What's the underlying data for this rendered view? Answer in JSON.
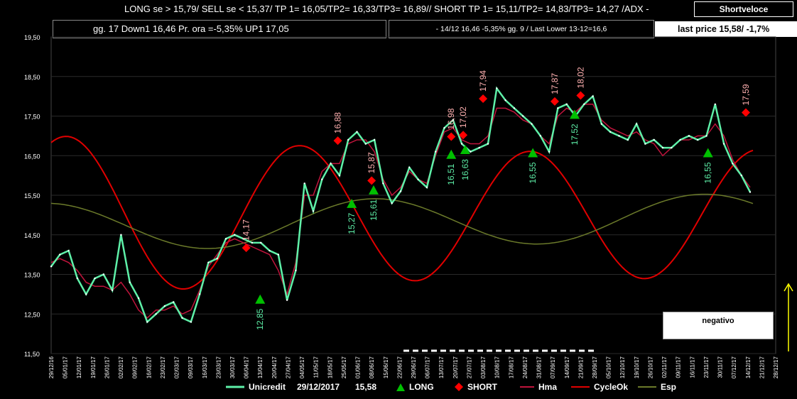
{
  "header": {
    "signals": "LONG se > 15,79/   SELL se < 15,37/ TP 1= 16,05/TP2= 16,33/TP3= 16,89//    SHORT TP 1= 15,11/TP2= 14,83/TP3= 14,27 /ADX -",
    "button": "Shortveloce"
  },
  "info": {
    "box1": "gg. 17  Down1  16,46  Pr. ora =-5,35%   UP1 17,05",
    "box2": "-  14/12  16,46  -5,35%  gg. 9 / Last Lower 13-12=16,6",
    "last_price": "last price 15,58/  -1,7%"
  },
  "status": {
    "label": "negativo"
  },
  "legend": {
    "unicredit": "Unicredit",
    "date": "29/12/2017",
    "price": "15,58",
    "long": "LONG",
    "short": "SHORT",
    "hma": "Hma",
    "cycleok": "CycleOk",
    "esp": "Esp"
  },
  "colors": {
    "price": "#5ef0a8",
    "long": "#00c000",
    "short": "#ff0000",
    "hma": "#c0143c",
    "cycleok": "#e00000",
    "esp": "#6b7a2a",
    "background": "#000000"
  },
  "chart_data": {
    "type": "line",
    "ylim": [
      11.5,
      19.5
    ],
    "yticks": [
      "11,50",
      "12,50",
      "13,50",
      "14,50",
      "15,50",
      "16,50",
      "17,50",
      "18,50",
      "19,50"
    ],
    "x_dates": [
      "29/12/16",
      "05/01/17",
      "12/01/17",
      "19/01/17",
      "26/01/17",
      "02/02/17",
      "09/02/17",
      "16/02/17",
      "23/02/17",
      "02/03/17",
      "09/03/17",
      "16/03/17",
      "23/03/17",
      "30/03/17",
      "06/04/17",
      "13/04/17",
      "20/04/17",
      "27/04/17",
      "04/05/17",
      "11/05/17",
      "18/05/17",
      "25/05/17",
      "01/06/17",
      "08/06/17",
      "15/06/17",
      "22/06/17",
      "29/06/17",
      "06/07/17",
      "13/07/17",
      "20/07/17",
      "27/07/17",
      "03/08/17",
      "10/08/17",
      "17/08/17",
      "24/08/17",
      "31/08/17",
      "07/09/17",
      "14/09/17",
      "21/09/17",
      "28/09/17",
      "05/10/17",
      "12/10/17",
      "19/10/17",
      "26/10/17",
      "02/11/17",
      "09/11/17",
      "16/11/17",
      "23/11/17",
      "30/11/17",
      "07/12/17",
      "14/12/17",
      "21/12/17",
      "28/12/17"
    ],
    "x_labels": [
      "29/12/16",
      "05/01/17",
      "12/01/17",
      "19/01/17",
      "26/01/17",
      "02/02/17",
      "09/02/17",
      "16/02/17",
      "23/02/17",
      "02/03/17",
      "09/03/17",
      "16/03/17",
      "23/03/17",
      "30/03/17",
      "06/04/17",
      "13/04/17",
      "20/04/17",
      "27/04/17",
      "04/05/17",
      "11/05/17",
      "18/05/17",
      "25/05/17",
      "01/06/17",
      "08/06/17",
      "15/06/17",
      "22/06/17",
      "29/06/17",
      "06/07/17",
      "13/07/17",
      "20/07/17",
      "27/07/17",
      "03/08/17",
      "10/08/17",
      "17/08/17",
      "24/08/17",
      "31/08/17",
      "07/09/17",
      "14/09/17",
      "21/09/17",
      "28/09/17",
      "05/10/17",
      "12/10/17",
      "19/10/17",
      "26/10/17",
      "02/11/17",
      "09/11/17",
      "16/11/17",
      "23/11/17",
      "30/11/17",
      "07/12/17",
      "14/12/17",
      "21/12/17",
      "28/12/17"
    ],
    "series": [
      {
        "name": "Unicredit",
        "values": [
          13.7,
          14.0,
          14.1,
          13.4,
          13.0,
          13.4,
          13.5,
          13.1,
          14.5,
          13.3,
          12.9,
          12.3,
          12.5,
          12.7,
          12.8,
          12.4,
          12.3,
          13.0,
          13.8,
          13.9,
          14.4,
          14.5,
          14.4,
          14.3,
          14.3,
          14.1,
          14.0,
          12.85,
          13.6,
          15.8,
          15.1,
          15.9,
          16.3,
          16.0,
          16.9,
          17.1,
          16.8,
          16.9,
          15.8,
          15.3,
          15.6,
          16.2,
          15.9,
          15.7,
          16.6,
          17.2,
          17.4,
          16.8,
          16.6,
          16.7,
          16.8,
          18.2,
          17.9,
          17.7,
          17.5,
          17.3,
          17.0,
          16.6,
          17.7,
          17.8,
          17.5,
          17.8,
          18.0,
          17.3,
          17.1,
          17.0,
          16.9,
          17.3,
          16.8,
          16.9,
          16.7,
          16.7,
          16.9,
          17.0,
          16.9,
          17.0,
          17.8,
          16.8,
          16.3,
          16.0,
          15.58
        ]
      },
      {
        "name": "Hma",
        "values": [
          13.8,
          13.9,
          13.8,
          13.6,
          13.3,
          13.2,
          13.2,
          13.1,
          13.3,
          13.0,
          12.6,
          12.4,
          12.6,
          12.6,
          12.7,
          12.5,
          12.6,
          13.1,
          13.7,
          14.0,
          14.3,
          14.4,
          14.3,
          14.2,
          14.1,
          14.0,
          13.6,
          13.0,
          13.8,
          15.5,
          15.5,
          16.1,
          16.3,
          16.3,
          16.8,
          16.9,
          16.9,
          16.6,
          15.9,
          15.5,
          15.7,
          16.1,
          15.9,
          15.8,
          16.5,
          17.1,
          17.2,
          16.9,
          16.8,
          16.8,
          17.0,
          17.7,
          17.7,
          17.6,
          17.4,
          17.3,
          17.0,
          16.8,
          17.5,
          17.7,
          17.6,
          17.8,
          17.8,
          17.4,
          17.2,
          17.1,
          17.0,
          17.1,
          16.9,
          16.8,
          16.5,
          16.7,
          16.9,
          16.9,
          17.0,
          17.0,
          17.3,
          17.0,
          16.4,
          16.0,
          15.7
        ]
      }
    ],
    "signals": {
      "long": [
        {
          "x": "13/04/17",
          "value": "12,85"
        },
        {
          "x": "29/05/17",
          "value": "15,27"
        },
        {
          "x": "09/06/17",
          "value": "15,61"
        },
        {
          "x": "18/07/17",
          "value": "16,51"
        },
        {
          "x": "25/07/17",
          "value": "16,63"
        },
        {
          "x": "28/08/17",
          "value": "16,55"
        },
        {
          "x": "18/09/17",
          "value": "17,52"
        },
        {
          "x": "24/11/17",
          "value": "16,55"
        }
      ],
      "short": [
        {
          "x": "06/04/17",
          "value": "14,17"
        },
        {
          "x": "22/05/17",
          "value": "16,88"
        },
        {
          "x": "08/06/17",
          "value": "15,87"
        },
        {
          "x": "18/07/17",
          "value": "16,98"
        },
        {
          "x": "24/07/17",
          "value": "17,02"
        },
        {
          "x": "03/08/17",
          "value": "17,94"
        },
        {
          "x": "08/09/17",
          "value": "17,87"
        },
        {
          "x": "21/09/17",
          "value": "18,02"
        },
        {
          "x": "13/12/17",
          "value": "17,59"
        }
      ]
    }
  }
}
